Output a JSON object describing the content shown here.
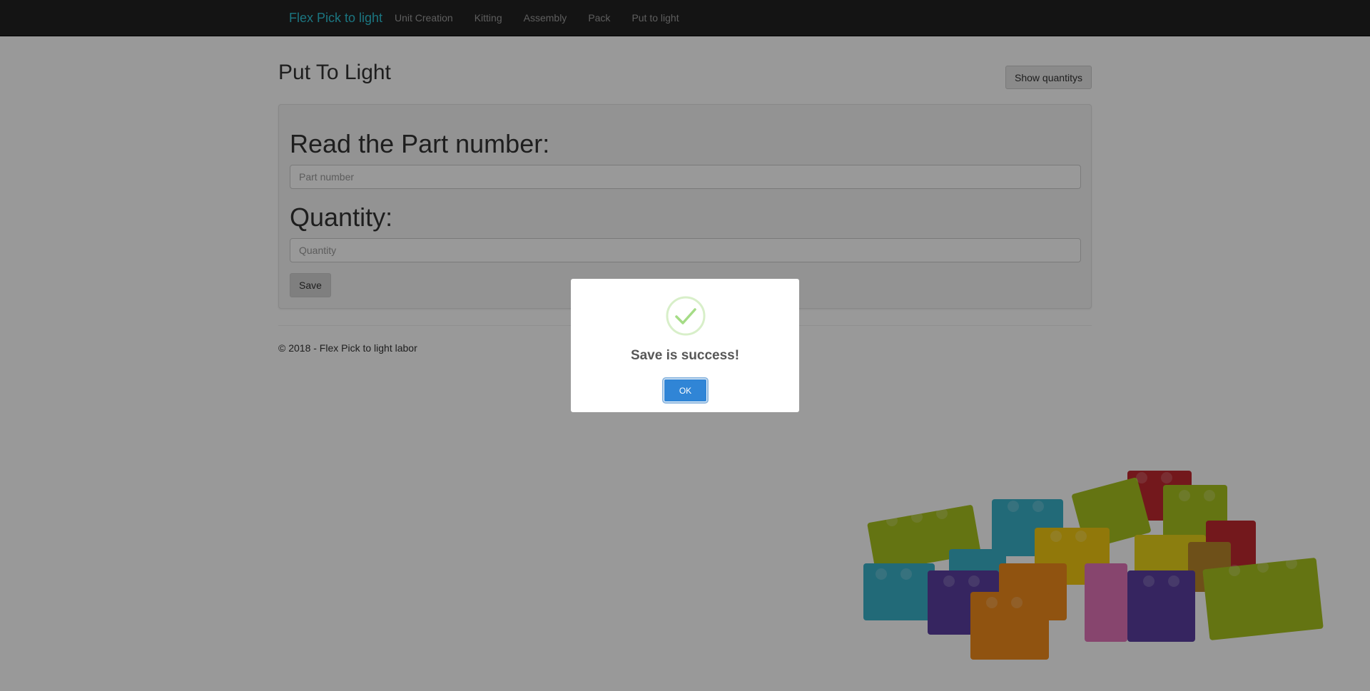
{
  "navbar": {
    "brand": "Flex Pick to light",
    "links": [
      {
        "label": "Unit Creation"
      },
      {
        "label": "Kitting"
      },
      {
        "label": "Assembly"
      },
      {
        "label": "Pack"
      },
      {
        "label": "Put to light"
      }
    ]
  },
  "main": {
    "title": "Put To Light",
    "show_quantities_label": "Show quantitys",
    "form": {
      "part_label": "Read the Part number:",
      "part_placeholder": "Part number",
      "part_value": "",
      "quantity_label": "Quantity:",
      "quantity_placeholder": "Quantity",
      "quantity_value": "",
      "save_label": "Save"
    }
  },
  "footer": {
    "text": "© 2018 - Flex Pick to light labor"
  },
  "modal": {
    "icon": "check-icon",
    "title": "Save is success!",
    "ok_label": "OK"
  },
  "colors": {
    "navbar_bg": "#222222",
    "brand": "#2ec4d6",
    "ok_button": "#3085d6",
    "success": "#a5dc86"
  },
  "background_image": "lego-bricks"
}
